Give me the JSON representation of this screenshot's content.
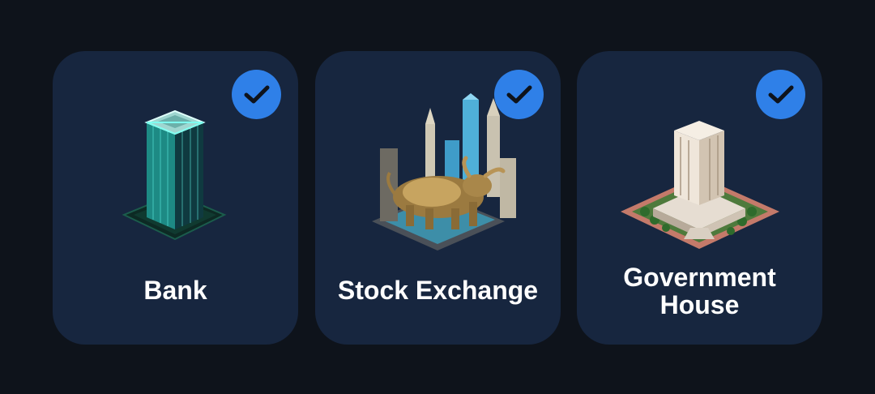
{
  "cards": [
    {
      "label": "Bank",
      "selected": true,
      "illustration": "skyscraper-illustration"
    },
    {
      "label": "Stock Exchange",
      "selected": true,
      "illustration": "bull-statue-illustration"
    },
    {
      "label": "Government House",
      "selected": true,
      "illustration": "capitol-building-illustration"
    }
  ],
  "colors": {
    "background": "#0e131b",
    "card": "#17263f",
    "check_badge": "#2f80e8",
    "check_mark": "#0e131b",
    "label": "#ffffff"
  },
  "icons": {
    "selected_badge": "checkmark-icon"
  }
}
